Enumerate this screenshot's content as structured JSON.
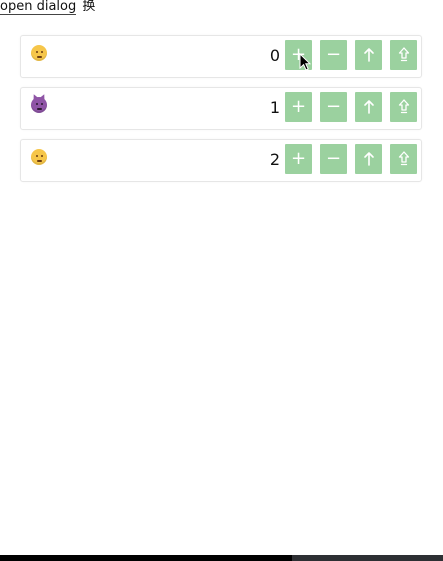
{
  "header": {
    "link_text": "open dialog",
    "suffix_text": "换"
  },
  "items": [
    {
      "emoji_icon": "neutral-face-icon",
      "value": "0",
      "buttons": {
        "plus_label": "+",
        "minus_label": "−",
        "up_icon": "up-arrow-icon",
        "top_icon": "up-arrow-outline-icon"
      }
    },
    {
      "emoji_icon": "smiling-imp-icon",
      "value": "1",
      "buttons": {
        "plus_label": "+",
        "minus_label": "−",
        "up_icon": "up-arrow-icon",
        "top_icon": "up-arrow-outline-icon"
      }
    },
    {
      "emoji_icon": "slight-smile-icon",
      "value": "2",
      "buttons": {
        "plus_label": "+",
        "minus_label": "−",
        "up_icon": "up-arrow-icon",
        "top_icon": "up-arrow-outline-icon"
      }
    }
  ],
  "colors": {
    "button": "#9bd19f",
    "row_border": "#e6e6e6"
  }
}
